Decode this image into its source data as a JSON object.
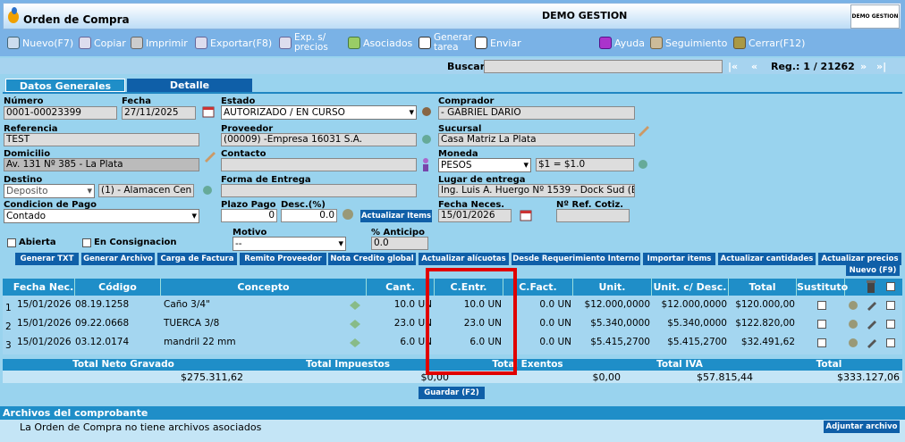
{
  "app": {
    "title": "Orden de Compra",
    "company": "DEMO GESTION",
    "logo_text": "DEMO GESTION"
  },
  "toolbar": {
    "nuevo": "Nuevo(F7)",
    "copiar": "Copiar",
    "imprimir": "Imprimir",
    "exportar": "Exportar(F8)",
    "exp1": "Exp. s/",
    "exp2": "precios",
    "asociados": "Asociados",
    "gen1": "Generar",
    "gen2": "tarea",
    "enviar": "Enviar",
    "ayuda": "Ayuda",
    "seguimiento": "Seguimiento",
    "cerrar": "Cerrar(F12)"
  },
  "nav": {
    "buscar": "Buscar",
    "first": "|«",
    "prev": "«",
    "reg": "Reg.: 1 / 21262",
    "next": "»",
    "last": "»|"
  },
  "tabs": [
    "Datos Generales",
    "Detalle"
  ],
  "form": {
    "numero_l": "Número",
    "numero": "0001-00023399",
    "fecha_l": "Fecha",
    "fecha": "27/11/2025",
    "estado_l": "Estado",
    "estado": "AUTORIZADO / EN CURSO",
    "comprador_l": "Comprador",
    "comprador": "- GABRIEL DARIO",
    "referencia_l": "Referencia",
    "referencia": "TEST",
    "proveedor_l": "Proveedor",
    "proveedor": "(00009) -Empresa 16031 S.A.",
    "sucursal_l": "Sucursal",
    "sucursal": "Casa Matriz La Plata",
    "domicilio_l": "Domicilio",
    "domicilio": "Av. 131 Nº 385 - La Plata",
    "contacto_l": "Contacto",
    "contacto": "",
    "moneda_l": "Moneda",
    "moneda": "PESOS",
    "cotiz": "$1 = $1.0",
    "destino_l": "Destino",
    "destino": "Deposito",
    "almacen": "(1) - Alamacen Cen",
    "forma_l": "Forma de Entrega",
    "forma": "",
    "lugar_l": "Lugar de entrega",
    "lugar": "Ing. Luis A. Huergo Nº 1539 - Dock Sud (B",
    "condicion_l": "Condicion de Pago",
    "condicion": "Contado",
    "plazo_l": "Plazo Pago",
    "plazo": "0",
    "desc_l": "Desc.(%)",
    "desc": "0.0",
    "actualizar_items": "Actualizar Items",
    "fnec_l": "Fecha Neces.",
    "fnec": "15/01/2026",
    "refcot_l": "Nº Ref. Cotiz.",
    "refcot": "",
    "abierta": "Abierta",
    "consignacion": "En Consignacion",
    "motivo_l": "Motivo",
    "motivo": "--",
    "anticipo_l": "% Anticipo",
    "anticipo": "0.0"
  },
  "actions": [
    "Generar TXT",
    "Generar Archivo",
    "Carga de Factura",
    "Remito Proveedor",
    "Nota Credito global",
    "Actualizar alícuotas",
    "Desde Requerimiento Interno",
    "Importar items",
    "Actualizar cantidades",
    "Actualizar precios"
  ],
  "nuevo_f9": "Nuevo (F9)",
  "table": {
    "headers": [
      "Fecha Nec.",
      "Código",
      "Concepto",
      "Cant.",
      "C.Entr.",
      "C.Fact.",
      "Unit.",
      "Unit. c/ Desc.",
      "Total",
      "Sustituto"
    ],
    "rows": [
      {
        "n": "1",
        "fecha": "15/01/2026",
        "codigo": "08.19.1258",
        "concepto": "Caño 3/4\"",
        "cant": "10.0 UN",
        "centr": "10.0 UN",
        "cfact": "0.0 UN",
        "unit": "$12.000,0000",
        "unitd": "$12.000,0000",
        "total": "$120.000,00"
      },
      {
        "n": "2",
        "fecha": "15/01/2026",
        "codigo": "09.22.0668",
        "concepto": "TUERCA 3/8",
        "cant": "23.0 UN",
        "centr": "23.0 UN",
        "cfact": "0.0 UN",
        "unit": "$5.340,0000",
        "unitd": "$5.340,0000",
        "total": "$122.820,00"
      },
      {
        "n": "3",
        "fecha": "15/01/2026",
        "codigo": "03.12.0174",
        "concepto": "mandril 22 mm",
        "cant": "6.0 UN",
        "centr": "6.0 UN",
        "cfact": "0.0 UN",
        "unit": "$5.415,2700",
        "unitd": "$5.415,2700",
        "total": "$32.491,62"
      }
    ]
  },
  "totals": {
    "h_neto": "Total Neto Gravado",
    "h_imp": "Total Impuestos",
    "h_exentos": "Total Exentos",
    "h_iva": "Total IVA",
    "h_total": "Total",
    "neto": "$275.311,62",
    "imp": "$0,00",
    "exentos": "$0,00",
    "iva": "$57.815,44",
    "total": "$333.127,06"
  },
  "guardar": "Guardar (F2)",
  "archivos": {
    "title": "Archivos del comprobante",
    "empty": "La Orden de Compra no tiene archivos asociados",
    "adjuntar": "Adjuntar archivo"
  },
  "colors": {
    "accent": "#0f5fa8",
    "header": "#1f8ec8",
    "highlight": "#e00000"
  }
}
